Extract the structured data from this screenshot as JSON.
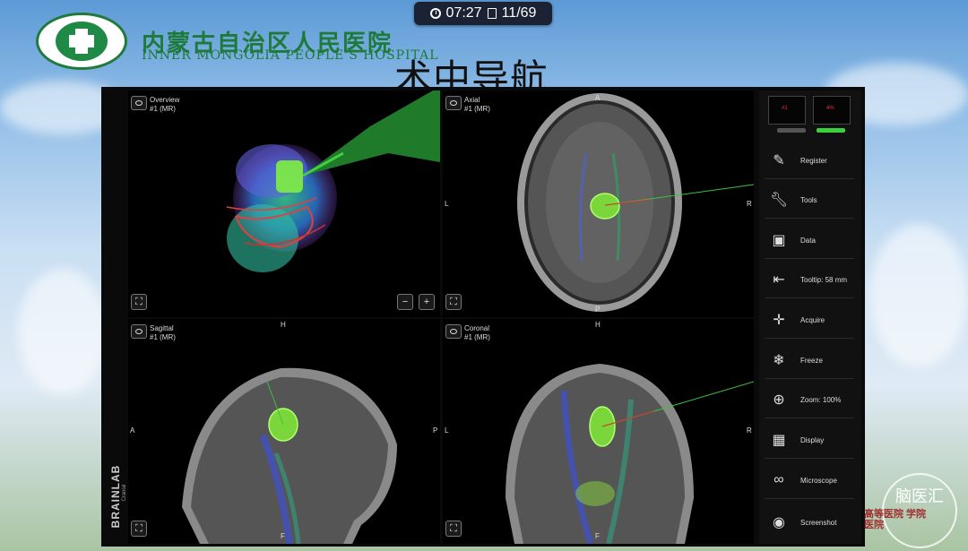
{
  "topbar": {
    "time": "07:27",
    "slide": "11/69"
  },
  "header": {
    "hospital_cn": "内蒙古自治区人民医院",
    "hospital_en": "INNER MONGOLIA PEOPLE'S HOSPITAL",
    "title": "术中导航"
  },
  "views": [
    {
      "name": "Overview",
      "series": "#1 (MR)",
      "orient": {}
    },
    {
      "name": "Axial",
      "series": "#1 (MR)",
      "orient": {
        "top": "A",
        "left": "L",
        "right": "R",
        "bottom": "P"
      }
    },
    {
      "name": "Sagittal",
      "series": "#1 (MR)",
      "orient": {
        "top": "H",
        "left": "A",
        "right": "P",
        "bottom": "F"
      }
    },
    {
      "name": "Coronal",
      "series": "#1 (MR)",
      "orient": {
        "top": "H",
        "left": "L",
        "right": "R",
        "bottom": "F"
      }
    }
  ],
  "brand": {
    "name": "BRAINLAB",
    "sub": "Cranial"
  },
  "panel": {
    "monitors": [
      {
        "label": "#1"
      },
      {
        "label": "4%"
      }
    ],
    "menu": [
      {
        "label": "Register",
        "icon": "register-icon"
      },
      {
        "label": "Tools",
        "icon": "wrench-icon"
      },
      {
        "label": "Data",
        "icon": "folder-user-icon"
      },
      {
        "label": "Tooltip: 58 mm",
        "icon": "pointer-tip-icon"
      },
      {
        "label": "Acquire",
        "icon": "acquire-icon"
      },
      {
        "label": "Freeze",
        "icon": "snowflake-icon"
      },
      {
        "label": "Zoom: 100%",
        "icon": "zoom-icon"
      },
      {
        "label": "Display",
        "icon": "layout-icon"
      },
      {
        "label": "Microscope",
        "icon": "microscope-icon"
      },
      {
        "label": "Screenshot",
        "icon": "camera-icon"
      }
    ]
  },
  "watermark": {
    "text": "脑医汇",
    "sub": "高等医院 学院医院"
  },
  "colors": {
    "logo_green": "#1e7a3a",
    "tumor_green": "#7ad63a",
    "bar_green": "#3ccf3c",
    "panel_bg": "#111111"
  }
}
